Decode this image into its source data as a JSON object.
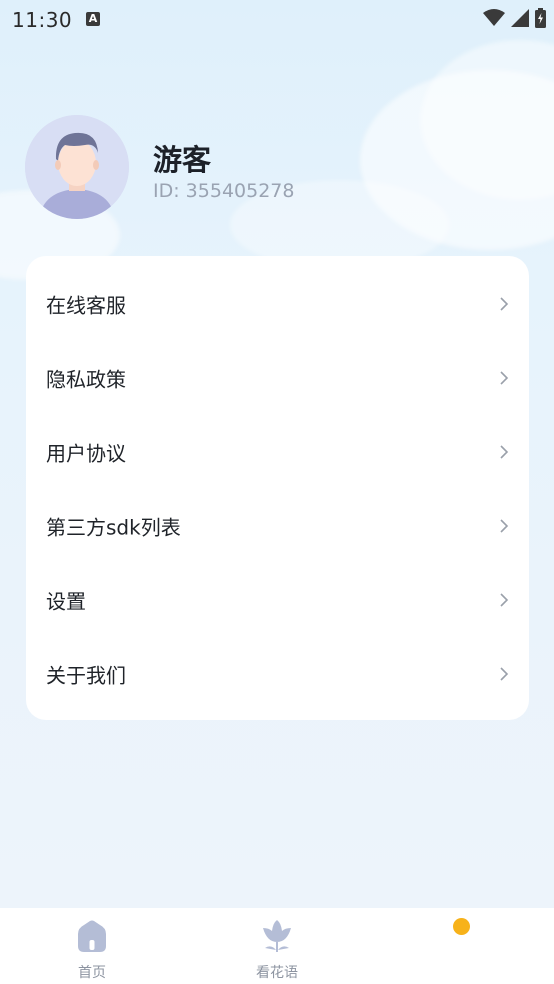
{
  "status_bar": {
    "time": "11:30",
    "notification_letter": "A"
  },
  "profile": {
    "username": "游客",
    "user_id": "ID: 355405278"
  },
  "menu": {
    "items": [
      {
        "label": "在线客服"
      },
      {
        "label": "隐私政策"
      },
      {
        "label": "用户协议"
      },
      {
        "label": "第三方sdk列表"
      },
      {
        "label": "设置"
      },
      {
        "label": "关于我们"
      }
    ]
  },
  "bottom_nav": {
    "items": [
      {
        "label": "首页",
        "icon": "home-icon"
      },
      {
        "label": "看花语",
        "icon": "flower-icon"
      },
      {
        "label": "",
        "icon": "profile-dot-icon"
      }
    ]
  },
  "colors": {
    "accent_dot": "#f7b21a",
    "nav_icon": "#b4bdd6",
    "card_bg": "#ffffff"
  }
}
